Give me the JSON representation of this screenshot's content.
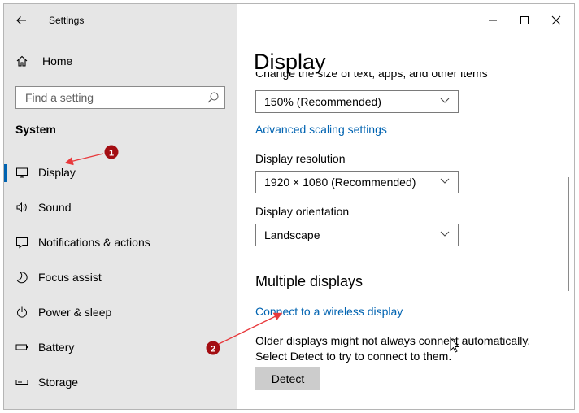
{
  "window": {
    "title": "Settings"
  },
  "sidebar": {
    "home_label": "Home",
    "search_placeholder": "Find a setting",
    "section_title": "System",
    "items": [
      {
        "label": "Display",
        "icon": "monitor-icon",
        "selected": true
      },
      {
        "label": "Sound",
        "icon": "speaker-icon"
      },
      {
        "label": "Notifications & actions",
        "icon": "notification-icon"
      },
      {
        "label": "Focus assist",
        "icon": "moon-icon"
      },
      {
        "label": "Power & sleep",
        "icon": "power-icon"
      },
      {
        "label": "Battery",
        "icon": "battery-icon"
      },
      {
        "label": "Storage",
        "icon": "storage-icon"
      }
    ]
  },
  "main": {
    "title": "Display",
    "scale_description": "Change the size of text, apps, and other items",
    "scale_value": "150% (Recommended)",
    "advanced_scaling_link": "Advanced scaling settings",
    "resolution_label": "Display resolution",
    "resolution_value": "1920 × 1080 (Recommended)",
    "orientation_label": "Display orientation",
    "orientation_value": "Landscape",
    "multiple_displays_heading": "Multiple displays",
    "wireless_link": "Connect to a wireless display",
    "older_displays_text": "Older displays might not always connect automatically. Select Detect to try to connect to them.",
    "detect_button": "Detect"
  },
  "annotations": [
    {
      "number": "1",
      "color": "#a30d12"
    },
    {
      "number": "2",
      "color": "#a30d12"
    }
  ],
  "colors": {
    "accent": "#0063b1",
    "sidebar_bg": "#e6e6e6",
    "annotation_arrow": "#e8393c"
  }
}
